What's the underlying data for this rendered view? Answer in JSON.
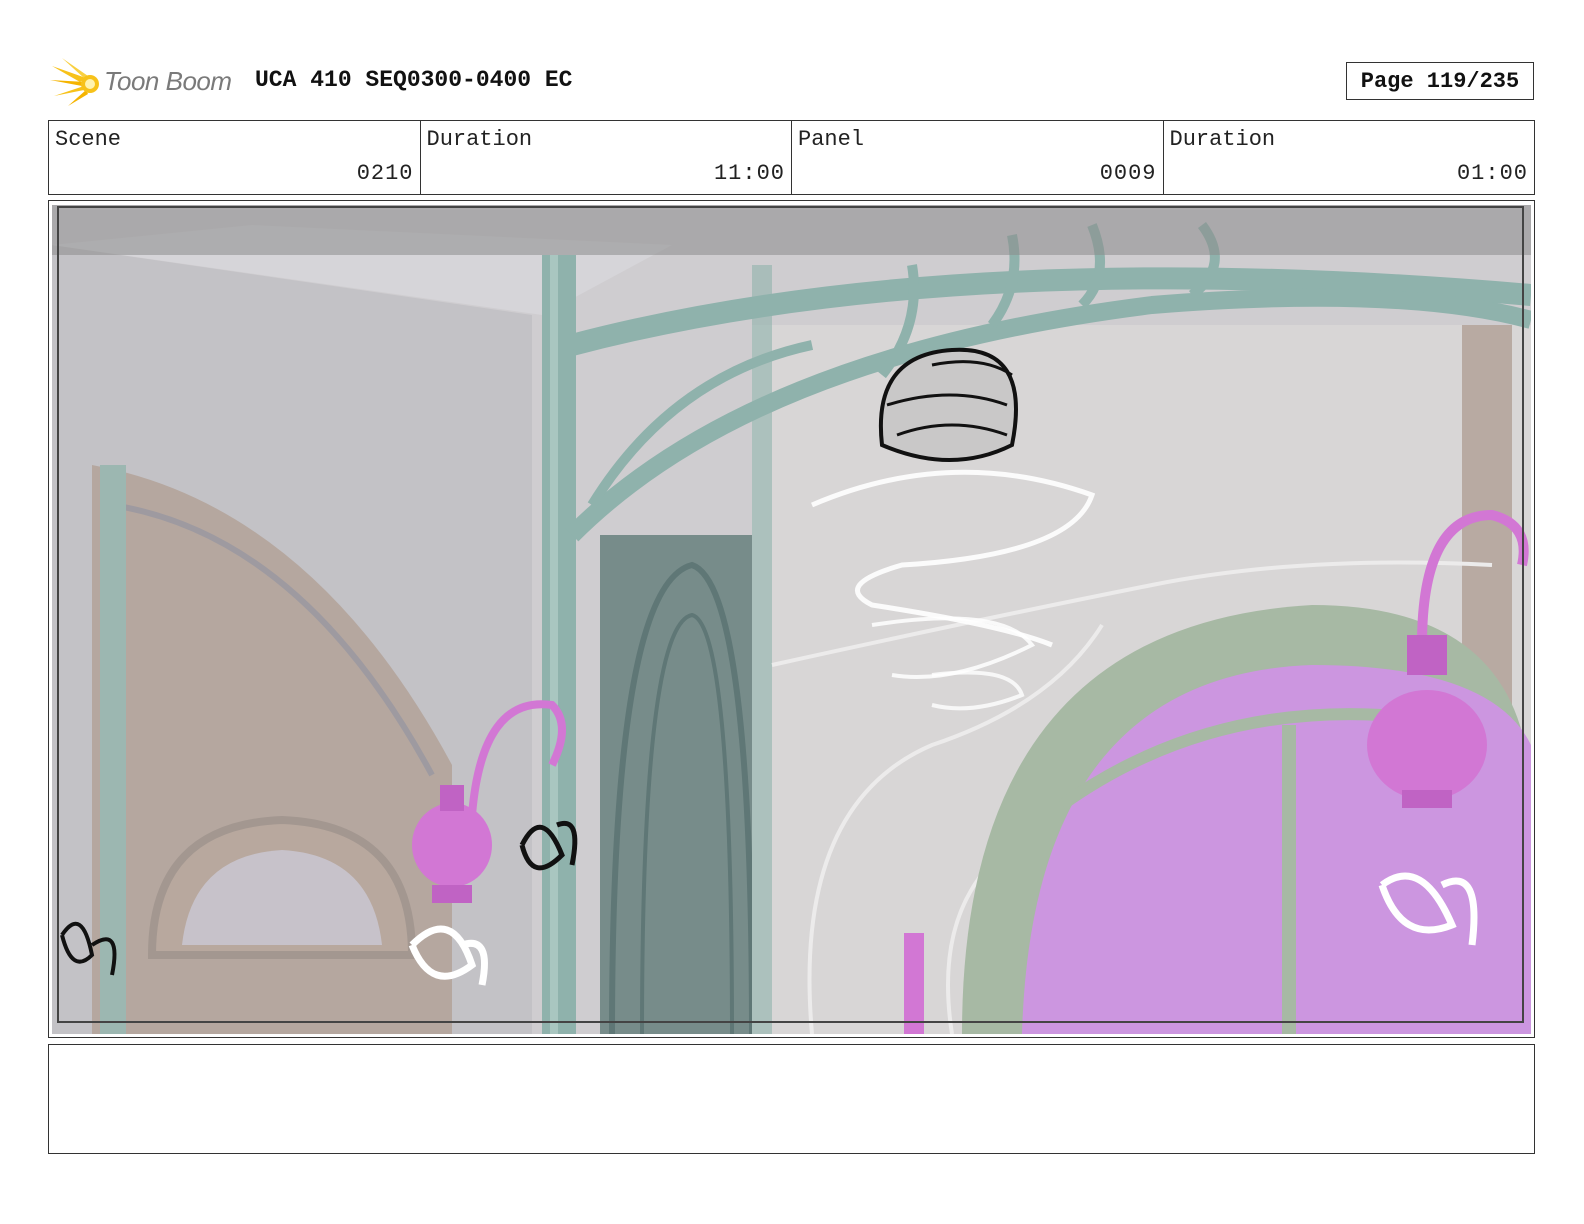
{
  "header": {
    "logo_text": "Toon Boom",
    "title": "UCA 410 SEQ0300-0400 EC",
    "page": "Page 119/235"
  },
  "info": [
    {
      "label": "Scene",
      "value": "0210"
    },
    {
      "label": "Duration",
      "value": "11:00"
    },
    {
      "label": "Panel",
      "value": "0009"
    },
    {
      "label": "Duration",
      "value": "01:00"
    }
  ],
  "panel": {
    "image": "storyboard-panel-artwork"
  },
  "notes": {
    "text": ""
  },
  "colors": {
    "logo_yellow": "#f7c21a",
    "lamp_magenta": "#d277d4",
    "ironwork_teal": "#8fb2ac",
    "window_purple": "#cc96e0",
    "frame_border": "#333333"
  }
}
